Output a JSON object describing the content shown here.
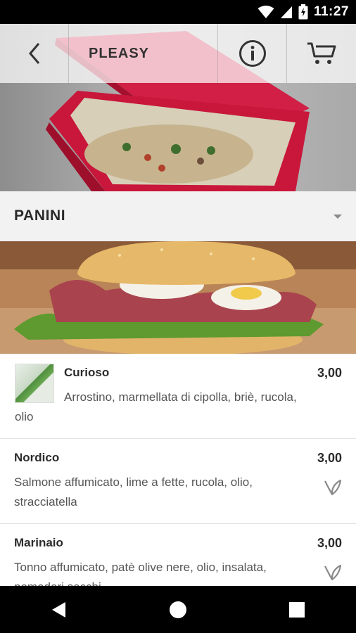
{
  "status_bar": {
    "time": "11:27",
    "icons": [
      "wifi-icon",
      "signal-icon",
      "battery-icon"
    ]
  },
  "header": {
    "title": "PLEASY",
    "icons": [
      "back-arrow-icon",
      "info-icon",
      "cart-icon"
    ]
  },
  "category": {
    "title": "PANINI",
    "icon": "dropdown-triangle-icon"
  },
  "products": [
    {
      "name": "Curioso",
      "price": "3,00",
      "description": "Arrostino, marmellata di cipolla, briè, rucola, olio",
      "has_thumbnail": true,
      "vegetarian": false
    },
    {
      "name": "Nordico",
      "price": "3,00",
      "description": "Salmone affumicato, lime a fette, rucola, olio, stracciatella",
      "has_thumbnail": false,
      "vegetarian": true
    },
    {
      "name": "Marinaio",
      "price": "3,00",
      "description": "Tonno affumicato, patè olive nere, olio, insalata, pomodori secchi",
      "has_thumbnail": false,
      "vegetarian": true
    }
  ],
  "nav_bar": {
    "icons": [
      "back-triangle-icon",
      "home-circle-icon",
      "recents-square-icon"
    ]
  },
  "colors": {
    "header_overlay": "#ffffff",
    "category_background": "#f2f2f2",
    "pizza_box": "#c8173a",
    "system_bar": "#000000"
  }
}
